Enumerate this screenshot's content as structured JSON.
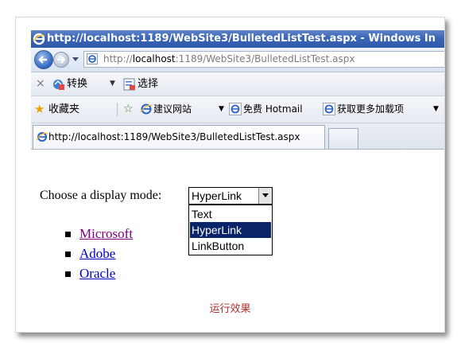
{
  "window": {
    "title": "http://localhost:1189/WebSite3/BulletedListTest.aspx - Windows In"
  },
  "nav": {
    "address_prefix": "http://",
    "address_host": "localhost",
    "address_rest": ":1189/WebSite3/BulletedListTest.aspx"
  },
  "command_bar": {
    "convert_label": "转换",
    "select_label": "选择"
  },
  "favorites_bar": {
    "favorites_label": "收藏夹",
    "items": [
      {
        "label": "建议网站"
      },
      {
        "label": "免费 Hotmail"
      },
      {
        "label": "获取更多加载项"
      }
    ]
  },
  "tabs": [
    {
      "label": "http://localhost:1189/WebSite3/BulletedListTest.aspx"
    }
  ],
  "page": {
    "prompt": "Choose a display mode:",
    "select_value": "HyperLink",
    "options": [
      "Text",
      "HyperLink",
      "LinkButton"
    ],
    "highlighted_option": "HyperLink",
    "links": [
      "Microsoft",
      "Adobe",
      "Oracle"
    ]
  },
  "caption": "运行效果"
}
